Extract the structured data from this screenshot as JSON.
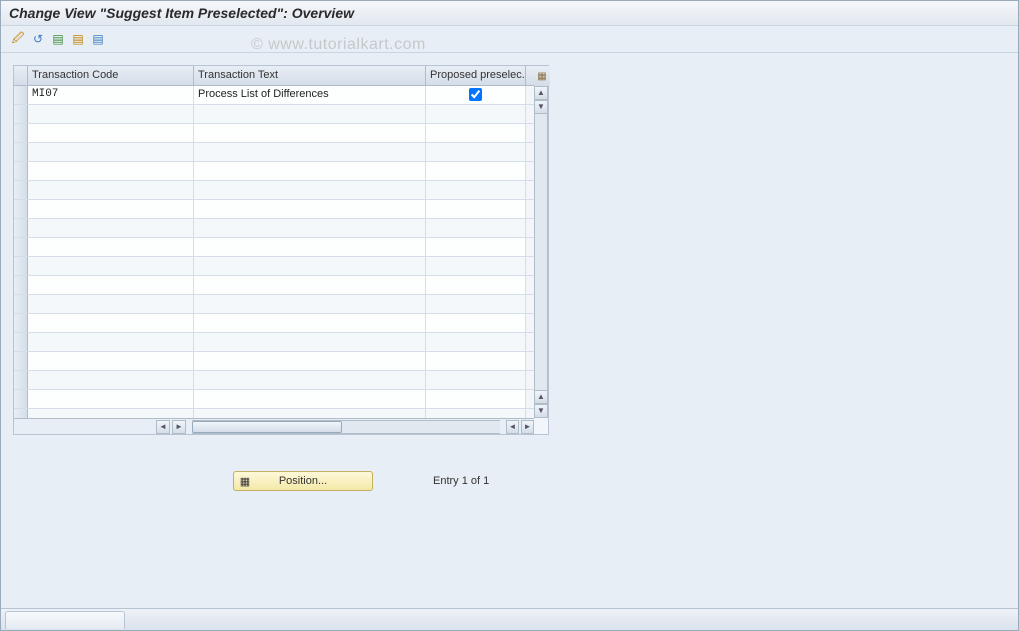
{
  "title": "Change View \"Suggest Item Preselected\": Overview",
  "watermark": "© www.tutorialkart.com",
  "toolbar": {
    "b1_icon": "🖉",
    "b2_icon": "↺",
    "b3_icon": "▤",
    "b4_icon": "▤",
    "b5_icon": "▤"
  },
  "table": {
    "columns": {
      "tcode": "Transaction Code",
      "ttext": "Transaction Text",
      "preselect": "Proposed preselec."
    },
    "config_icon": "▦",
    "rows": [
      {
        "tcode": "MI07",
        "ttext": "Process List of Differences",
        "preselect": true
      }
    ],
    "empty_row_count": 17
  },
  "scroll": {
    "up": "▲",
    "down": "▼",
    "left": "◄",
    "right": "►"
  },
  "footer": {
    "position_label": "Position...",
    "position_icon": "▦",
    "entry_text": "Entry 1 of 1"
  }
}
